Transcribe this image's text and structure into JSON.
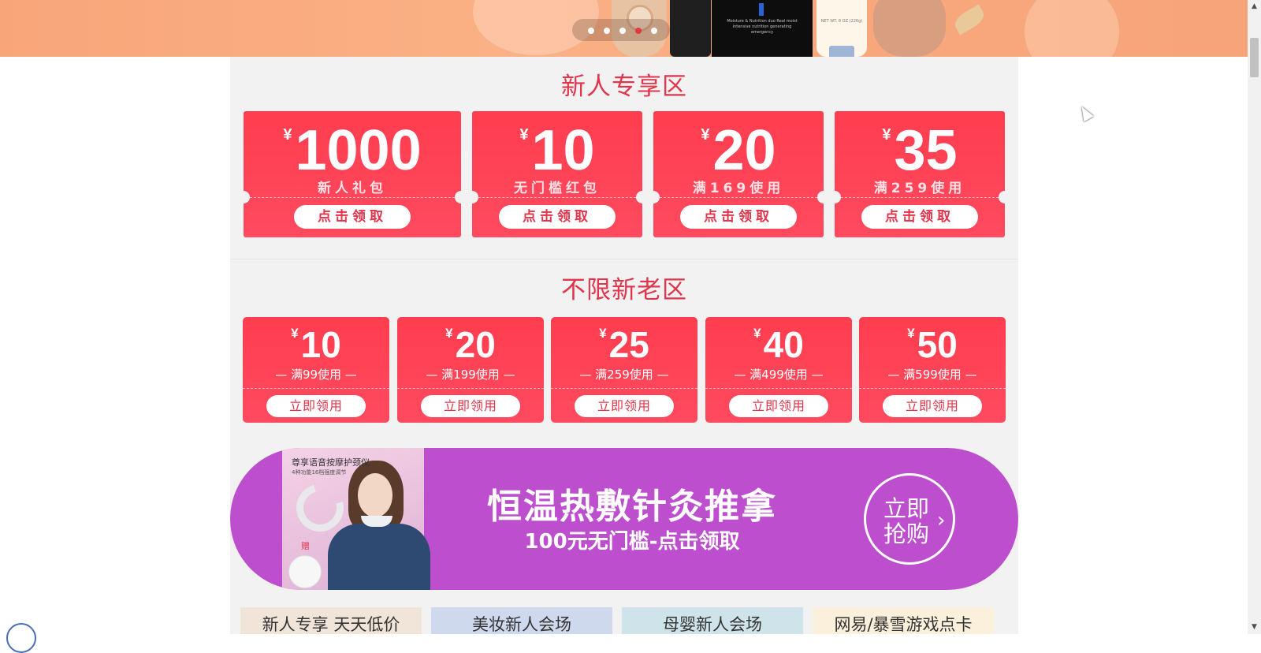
{
  "hero": {
    "product_text": "Moisture & Nutrition duo\nReal moist intensive nutrition generating emergency",
    "tube_text": "NET WT. 8 OZ (226g)",
    "carousel_dots": 5,
    "active_dot": 4
  },
  "new_user_section": {
    "title": "新人专享区",
    "coupons": [
      {
        "currency": "¥",
        "amount": "1000",
        "desc": "新人礼包",
        "button": "点击领取"
      },
      {
        "currency": "¥",
        "amount": "10",
        "desc": "无门槛红包",
        "button": "点击领取"
      },
      {
        "currency": "¥",
        "amount": "20",
        "desc": "满169使用",
        "button": "点击领取"
      },
      {
        "currency": "¥",
        "amount": "35",
        "desc": "满259使用",
        "button": "点击领取"
      }
    ]
  },
  "all_user_section": {
    "title": "不限新老区",
    "coupons": [
      {
        "currency": "¥",
        "amount": "10",
        "desc": "— 满99使用 —",
        "button": "立即领用"
      },
      {
        "currency": "¥",
        "amount": "20",
        "desc": "— 满199使用 —",
        "button": "立即领用"
      },
      {
        "currency": "¥",
        "amount": "25",
        "desc": "— 满259使用 —",
        "button": "立即领用"
      },
      {
        "currency": "¥",
        "amount": "40",
        "desc": "— 满499使用 —",
        "button": "立即领用"
      },
      {
        "currency": "¥",
        "amount": "50",
        "desc": "— 满599使用 —",
        "button": "立即领用"
      }
    ]
  },
  "promo": {
    "image_caption": "尊享语音按摩护颈仪",
    "image_subcaption": "4种功能16档强度调节",
    "gift_label": "赠",
    "title": "恒温热敷针灸推拿",
    "subtitle": "100元无门槛-点击领取",
    "cta_line1": "立即",
    "cta_line2": "抢购",
    "cta_arrow": "›",
    "color": "#bd4fcf"
  },
  "tabs": [
    {
      "label": "新人专享 天天低价",
      "bg": "#f1e4d8"
    },
    {
      "label": "美妆新人会场",
      "bg": "#cfd9ee"
    },
    {
      "label": "母婴新人会场",
      "bg": "#cfe3ea"
    },
    {
      "label": "网易/暴雪游戏点卡",
      "bg": "#fbf0dc"
    }
  ],
  "colors": {
    "accent": "#e2344a",
    "coupon": "#ff4354",
    "page_bg": "#f2f2f2"
  },
  "icons": {
    "scroll_up": "▲",
    "scroll_down": "▼"
  }
}
